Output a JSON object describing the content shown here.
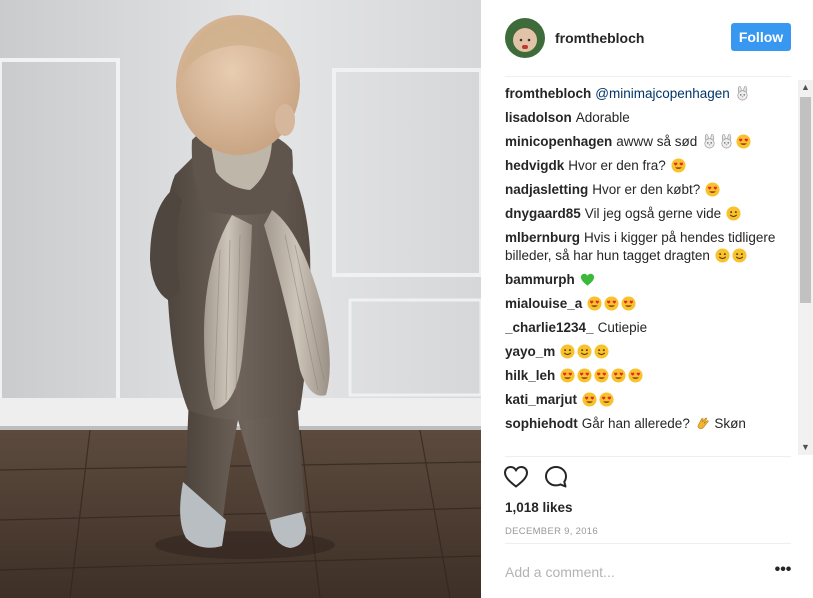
{
  "post": {
    "username": "fromthebloch",
    "follow_label": "Follow",
    "likes": "1,018 likes",
    "date": "DECEMBER 9, 2016",
    "comment_placeholder": "Add a comment...",
    "more_label": "•••"
  },
  "icons": {
    "avatar": "avatar",
    "like": "heart-icon",
    "comment": "comment-bubble-icon",
    "more": "more-options-icon",
    "scroll_up": "scroll-up-arrow",
    "scroll_down": "scroll-down-arrow"
  },
  "colors": {
    "follow_button": "#3897f0",
    "mention": "#003569",
    "date": "#999999",
    "placeholder": "#b3b3b3"
  },
  "comments": [
    {
      "user": "fromthebloch",
      "mention": "@minimajcopenhagen",
      "text": "",
      "emojis": [
        "rabbit-face"
      ]
    },
    {
      "user": "lisadolson",
      "text": "Adorable",
      "emojis": []
    },
    {
      "user": "minicopenhagen",
      "text": "awww så sød",
      "emojis": [
        "rabbit-face",
        "rabbit-face",
        "heart-eyes"
      ]
    },
    {
      "user": "hedvigdk",
      "text": "Hvor er den fra?",
      "emojis": [
        "heart-eyes"
      ]
    },
    {
      "user": "nadjasletting",
      "text": "Hvor er den købt?",
      "emojis": [
        "heart-eyes"
      ]
    },
    {
      "user": "dnygaard85",
      "text": "Vil jeg også gerne vide",
      "emojis": [
        "smile"
      ]
    },
    {
      "user": "mlbernburg",
      "text": "Hvis i kigger på hendes tidligere billeder, så har hun tagget dragten",
      "emojis": [
        "smile",
        "smile"
      ]
    },
    {
      "user": "bammurph",
      "text": "",
      "emojis": [
        "green-heart"
      ]
    },
    {
      "user": "mialouise_a",
      "text": "",
      "emojis": [
        "heart-eyes",
        "heart-eyes",
        "heart-eyes"
      ]
    },
    {
      "user": "_charlie1234_",
      "text": "Cutiepie",
      "emojis": []
    },
    {
      "user": "yayo_m",
      "text": "",
      "emojis": [
        "smile",
        "smile",
        "smile"
      ]
    },
    {
      "user": "hilk_leh",
      "text": "",
      "emojis": [
        "heart-eyes",
        "heart-eyes",
        "heart-eyes",
        "heart-eyes",
        "heart-eyes"
      ]
    },
    {
      "user": "kati_marjut",
      "text": "",
      "emojis": [
        "heart-eyes",
        "heart-eyes"
      ]
    },
    {
      "user": "sophiehodt",
      "text": "Går han allerede?",
      "emojis": [
        "clap"
      ],
      "after": "Skøn"
    }
  ]
}
